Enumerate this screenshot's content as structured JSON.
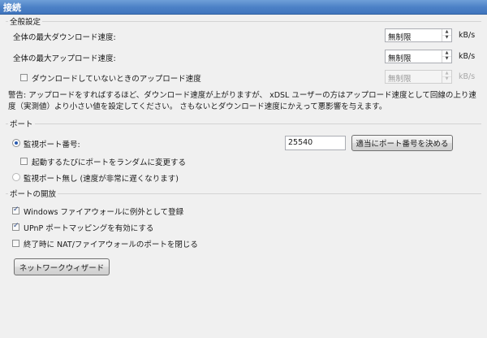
{
  "header": {
    "title": "接続"
  },
  "general": {
    "title": "全般設定",
    "max_download": {
      "label": "全体の最大ダウンロード速度:",
      "value": "無制限",
      "unit": "kB/s"
    },
    "max_upload": {
      "label": "全体の最大アップロード速度:",
      "value": "無制限",
      "unit": "kB/s"
    },
    "idle_upload": {
      "label": "ダウンロードしていないときのアップロード速度",
      "checked": false,
      "value": "無制限",
      "unit": "kB/s",
      "enabled": false
    },
    "warning": "警告: アップロードをすればするほど、ダウンロード速度が上がりますが、 xDSL ユーザーの方はアップロード速度として回線の上り速度（実測値）より小さい値を設定してください。 さもないとダウンロード速度にかえって悪影響を与えます。"
  },
  "port": {
    "title": "ポート",
    "listen_port": {
      "label": "監視ポート番号:",
      "selected": true,
      "value": "25540"
    },
    "random_port_button": "適当にポート番号を決める",
    "randomize_on_start": {
      "label": "起動するたびにポートをランダムに変更する",
      "checked": false
    },
    "no_listen": {
      "label": "監視ポート無し (速度が非常に遅くなります)",
      "selected": false
    }
  },
  "port_opening": {
    "title": "ポートの開放",
    "firewall_exception": {
      "label": "Windows ファイアウォールに例外として登録",
      "checked": true
    },
    "upnp": {
      "label": "UPnP ポートマッピングを有効にする",
      "checked": true
    },
    "close_on_exit": {
      "label": "終了時に NAT/ファイアウォールのポートを閉じる",
      "checked": false
    }
  },
  "network_wizard_button": "ネットワークウィザード"
}
